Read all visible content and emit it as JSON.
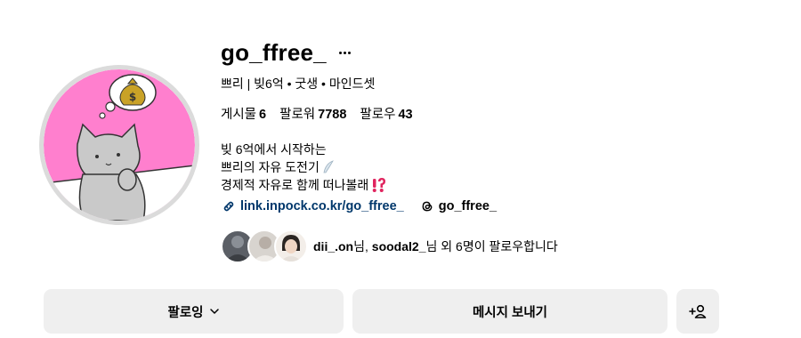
{
  "profile": {
    "username": "go_ffree_",
    "full_name": "쁘리 | 빚6억 • 굿생 • 마인드셋",
    "avatar_icon": "cartoon-cat-money-dream",
    "avatar_bg_color": "#ff7fce"
  },
  "stats": {
    "posts_label": "게시물",
    "posts_count": "6",
    "followers_label": "팔로워",
    "followers_count": "7788",
    "following_label": "팔로우",
    "following_count": "43"
  },
  "bio": {
    "line1": "빚 6억에서 시작하는",
    "line2": "쁘리의 자유 도전기",
    "line2_emoji": "feather-icon",
    "line3": "경제적 자유로 함께 떠나볼래",
    "line3_emoji": "exclamation-question-mark-icon"
  },
  "links": {
    "url": "link.inpock.co.kr/go_ffree_",
    "threads_handle": "go_ffree_",
    "link_color": "#00376b"
  },
  "followed_by": {
    "user1": "dii_.on",
    "suffix1": "님, ",
    "user2": "soodal2_",
    "suffix2": "님 외 6명이 팔로우합니다"
  },
  "actions": {
    "following_label": "팔로잉",
    "message_label": "메시지 보내기",
    "suggest_icon": "add-person-icon",
    "button_bg": "#efefef"
  }
}
